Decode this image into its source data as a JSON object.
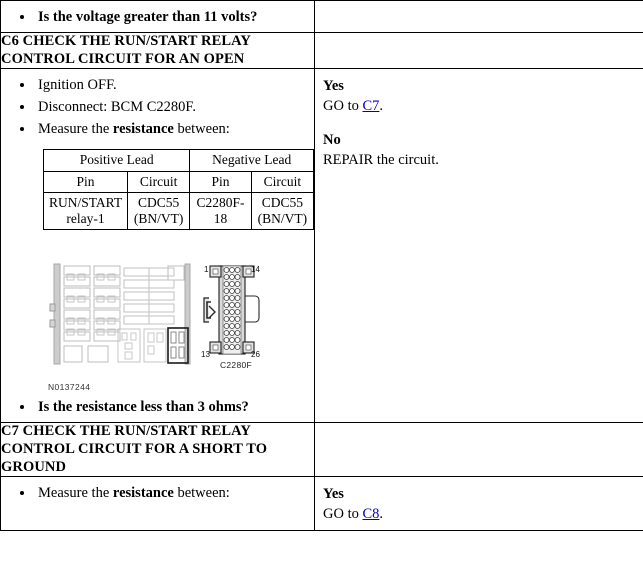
{
  "document": {
    "type": "pinpoint-test-table",
    "figure_caption": "N0137244"
  },
  "top_row": {
    "question": "Is the voltage greater than 11 volts?"
  },
  "steps": [
    {
      "id": "C6",
      "header": "C6 CHECK THE RUN/START RELAY CONTROL CIRCUIT FOR AN OPEN",
      "header_line1": "C6 CHECK THE RUN/START RELAY",
      "header_line2": "CONTROL CIRCUIT FOR AN OPEN",
      "instructions": [
        "Ignition OFF.",
        "Disconnect: BCM C2280F.",
        "Measure the resistance between:"
      ],
      "instruction_3_prefix": "Measure the ",
      "instruction_3_bold": "resistance",
      "instruction_3_suffix": " between:",
      "measure_table": {
        "group_headers": [
          "Positive Lead",
          "Negative Lead"
        ],
        "sub_headers": [
          "Pin",
          "Circuit",
          "Pin",
          "Circuit"
        ],
        "rows": [
          [
            "RUN/START relay-1",
            "CDC55 (BN/VT)",
            "C2280F-18",
            "CDC55 (BN/VT)"
          ]
        ]
      },
      "question": "Is the resistance less than 3 ohms?",
      "answers": [
        {
          "label": "Yes",
          "action_prefix": "GO to ",
          "link": "C7",
          "action_suffix": "."
        },
        {
          "label": "No",
          "action_prefix": "REPAIR the circuit.",
          "link": "",
          "action_suffix": ""
        }
      ]
    },
    {
      "id": "C7",
      "header": "C7 CHECK THE RUN/START RELAY CONTROL CIRCUIT FOR A SHORT TO GROUND",
      "header_line1": "C7 CHECK THE RUN/START RELAY",
      "header_line2": "CONTROL CIRCUIT FOR A SHORT TO",
      "header_line3": "GROUND",
      "instructions": [
        "Measure the resistance between:"
      ],
      "instruction_1_prefix": "Measure the ",
      "instruction_1_bold": "resistance",
      "instruction_1_suffix": " between:",
      "answers": [
        {
          "label": "Yes",
          "action_prefix": "GO to ",
          "link": "C8",
          "action_suffix": "."
        }
      ]
    }
  ],
  "figure": {
    "connector_label": "C2280F",
    "pin_numbers": {
      "top_left": "1",
      "top_right": "14",
      "bottom_left": "13",
      "bottom_right": "26"
    },
    "caption": "N0137244"
  },
  "colors": {
    "link": "#0000cc",
    "border": "#000000",
    "text": "#000000",
    "figure_gray": "#b8b8b8"
  }
}
